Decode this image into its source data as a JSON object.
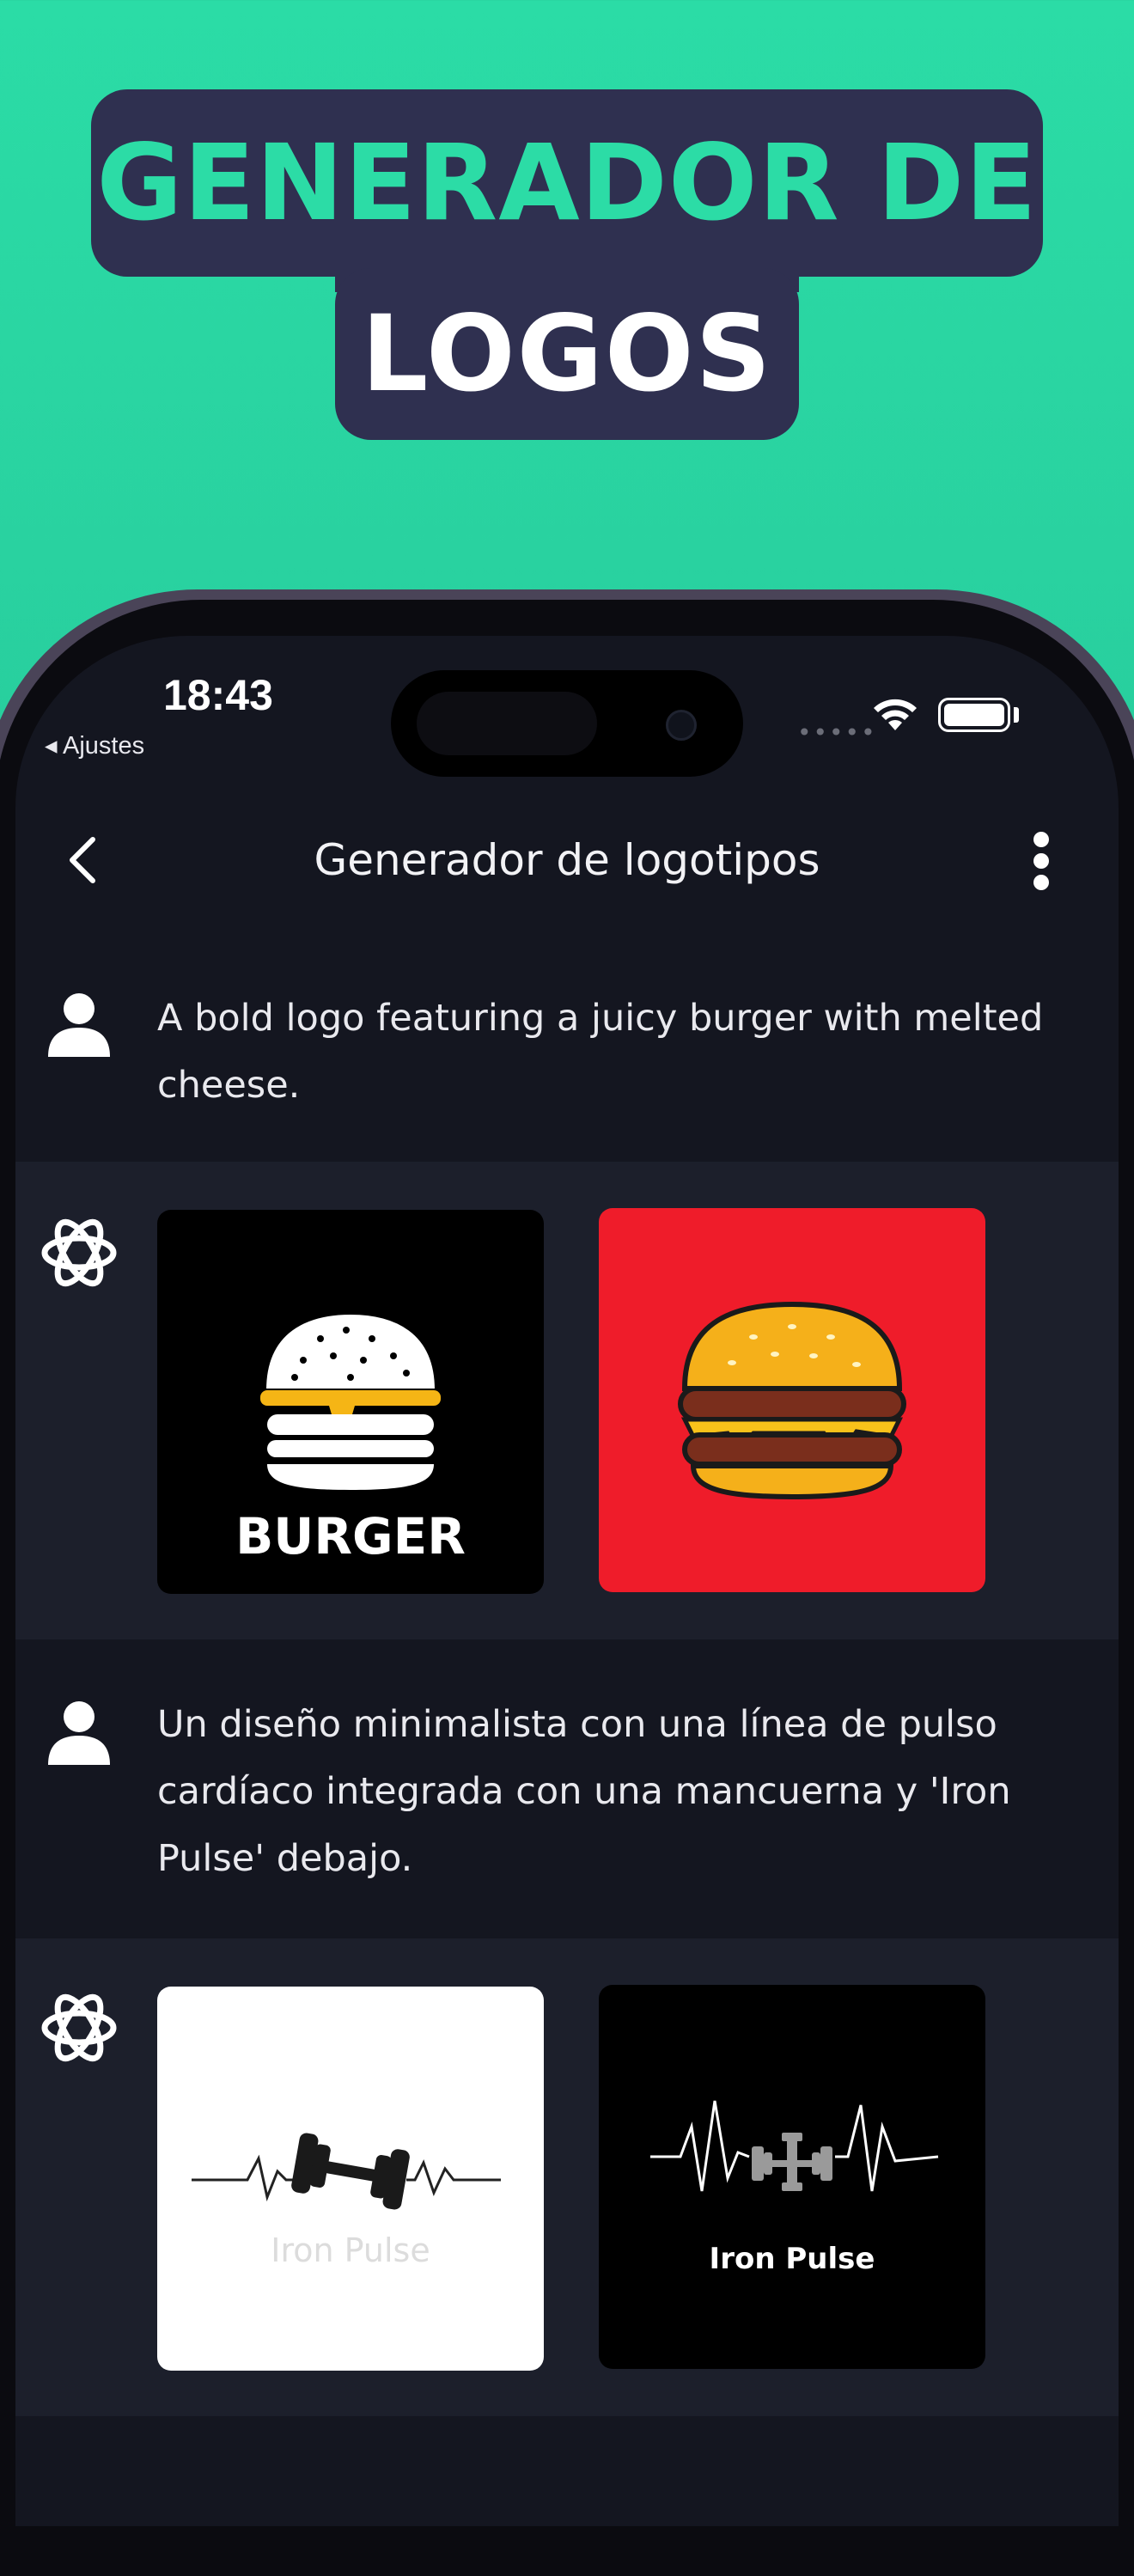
{
  "headline": {
    "line1": "GENERADOR DE",
    "line2": "LOGOS"
  },
  "status_bar": {
    "time": "18:43",
    "back_label": "◂ Ajustes",
    "dots": "•••••"
  },
  "header": {
    "title": "Generador de logotipos"
  },
  "conversation": [
    {
      "role": "user",
      "text": "A bold logo featuring a juicy burger with melted cheese."
    },
    {
      "role": "assistant",
      "images": [
        {
          "label": "BURGER",
          "background": "#000000",
          "icon": "burger-logo-icon"
        },
        {
          "label": "",
          "background": "#ef1c2a",
          "icon": "burger-illustration-icon"
        }
      ]
    },
    {
      "role": "user",
      "text": "Un diseño minimalista con una línea de pulso cardíaco integrada con una mancuerna y 'Iron Pulse' debajo."
    },
    {
      "role": "assistant",
      "images": [
        {
          "label": "Iron Pulse",
          "background": "#ffffff",
          "icon": "heartbeat-dumbbell-icon"
        },
        {
          "label": "Iron Pulse",
          "background": "#000000",
          "icon": "heartbeat-dumbbell-icon"
        }
      ]
    }
  ],
  "colors": {
    "background_top": "#2bdca6",
    "headline_box": "#2f3050",
    "headline_accent": "#2cdca6",
    "screen_bg": "#141620",
    "assistant_band": "#1c1f2b"
  }
}
